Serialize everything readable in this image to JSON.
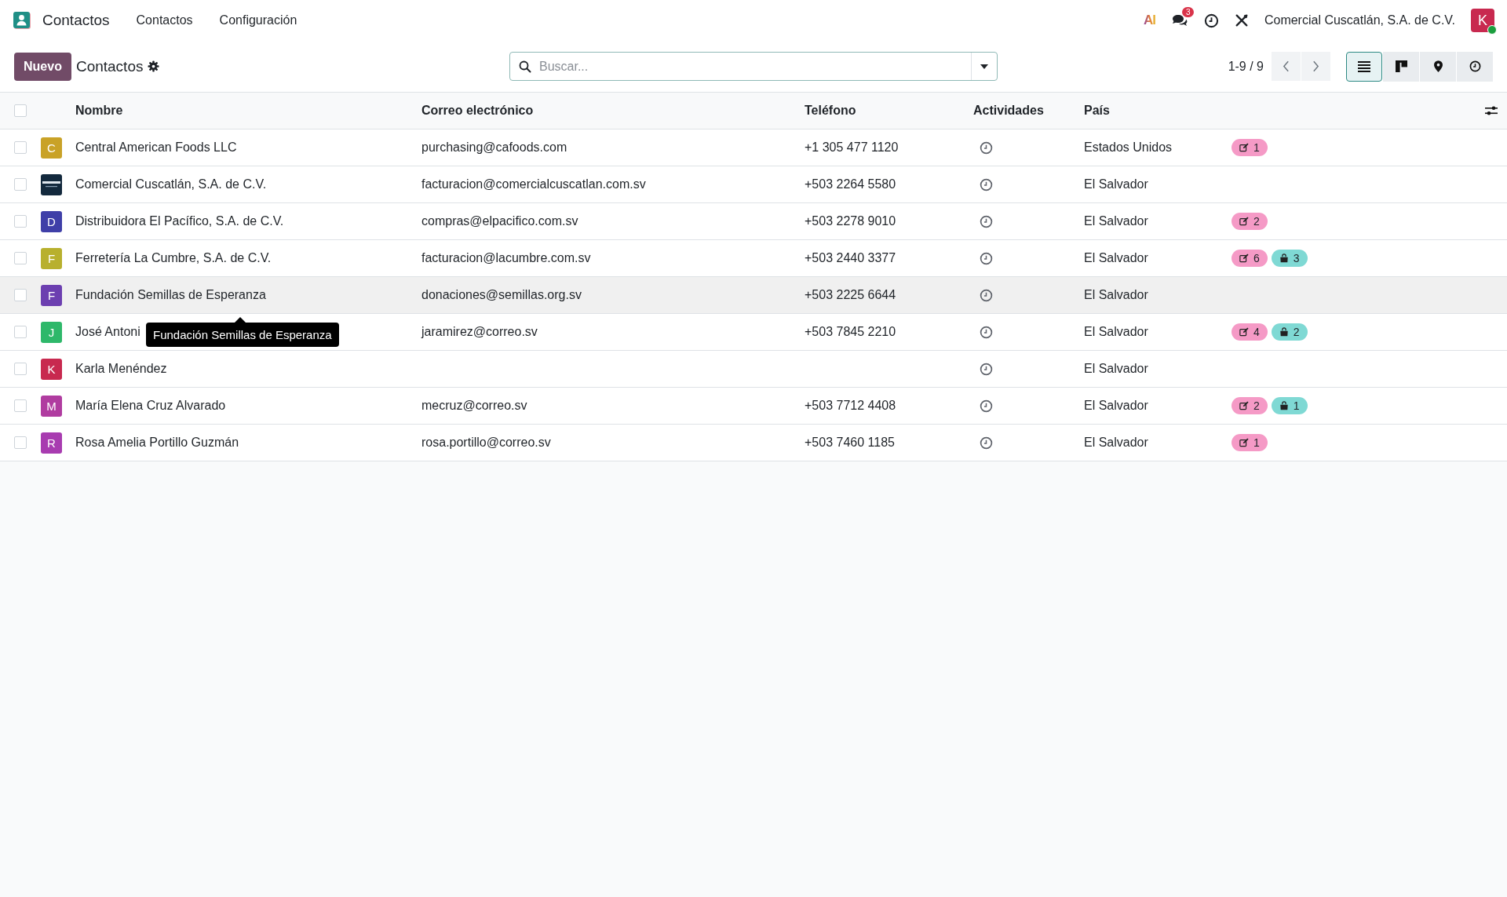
{
  "navbar": {
    "app_name": "Contactos",
    "menus": [
      "Contactos",
      "Configuración"
    ],
    "ai_label": "AI",
    "messages_badge": "3",
    "company": "Comercial Cuscatlán, S.A. de C.V.",
    "user_initial": "K",
    "user_online": true
  },
  "control_panel": {
    "new_button": "Nuevo",
    "title": "Contactos",
    "search": {
      "placeholder": "Buscar..."
    },
    "pager": "1-9 / 9",
    "views": [
      {
        "kind": "list",
        "selected": true
      },
      {
        "kind": "kanban",
        "selected": false
      },
      {
        "kind": "map",
        "selected": false
      },
      {
        "kind": "activity",
        "selected": false
      }
    ]
  },
  "table": {
    "all_selected": false,
    "columns": [
      "Nombre",
      "Correo electrónico",
      "Teléfono",
      "Actividades",
      "País"
    ],
    "rows": [
      {
        "avatar": {
          "kind": "letter",
          "letter": "C",
          "color": "#c9a227"
        },
        "name": "Central American Foods LLC",
        "email": "purchasing@cafoods.com",
        "phone": "+1 305 477 1120",
        "country": "Estados Unidos",
        "hovered": false,
        "badges": [
          {
            "kind": "note",
            "count": "1"
          }
        ]
      },
      {
        "avatar": {
          "kind": "logo"
        },
        "name": "Comercial Cuscatlán, S.A. de C.V.",
        "email": "facturacion@comercialcuscatlan.com.sv",
        "phone": "+503 2264 5580",
        "country": "El Salvador",
        "hovered": false,
        "badges": []
      },
      {
        "avatar": {
          "kind": "letter",
          "letter": "D",
          "color": "#3f3fa8"
        },
        "name": "Distribuidora El Pacífico, S.A. de C.V.",
        "email": "compras@elpacifico.com.sv",
        "phone": "+503 2278 9010",
        "country": "El Salvador",
        "hovered": false,
        "badges": [
          {
            "kind": "note",
            "count": "2"
          }
        ]
      },
      {
        "avatar": {
          "kind": "letter",
          "letter": "F",
          "color": "#b8b02e"
        },
        "name": "Ferretería La Cumbre, S.A. de C.V.",
        "email": "facturacion@lacumbre.com.sv",
        "phone": "+503 2440 3377",
        "country": "El Salvador",
        "hovered": false,
        "badges": [
          {
            "kind": "note",
            "count": "6"
          },
          {
            "kind": "bag",
            "count": "3"
          }
        ]
      },
      {
        "avatar": {
          "kind": "letter",
          "letter": "F",
          "color": "#6c3fb0"
        },
        "name": "Fundación Semillas de Esperanza",
        "email": "donaciones@semillas.org.sv",
        "phone": "+503 2225 6644",
        "country": "El Salvador",
        "hovered": true,
        "badges": []
      },
      {
        "avatar": {
          "kind": "letter",
          "letter": "J",
          "color": "#2eb86a"
        },
        "name": "José Antoni",
        "email": "jaramirez@correo.sv",
        "phone": "+503 7845 2210",
        "country": "El Salvador",
        "hovered": false,
        "badges": [
          {
            "kind": "note",
            "count": "4"
          },
          {
            "kind": "bag",
            "count": "2"
          }
        ]
      },
      {
        "avatar": {
          "kind": "letter",
          "letter": "K",
          "color": "#c8294f"
        },
        "name": "Karla Menéndez",
        "email": "",
        "phone": "",
        "country": "El Salvador",
        "hovered": false,
        "badges": []
      },
      {
        "avatar": {
          "kind": "letter",
          "letter": "M",
          "color": "#b03ca0"
        },
        "name": "María Elena Cruz Alvarado",
        "email": "mecruz@correo.sv",
        "phone": "+503 7712 4408",
        "country": "El Salvador",
        "hovered": false,
        "badges": [
          {
            "kind": "note",
            "count": "2"
          },
          {
            "kind": "bag",
            "count": "1"
          }
        ]
      },
      {
        "avatar": {
          "kind": "letter",
          "letter": "R",
          "color": "#a83cb0"
        },
        "name": "Rosa Amelia Portillo Guzmán",
        "email": "rosa.portillo@correo.sv",
        "phone": "+503 7460 1185",
        "country": "El Salvador",
        "hovered": false,
        "badges": [
          {
            "kind": "note",
            "count": "1"
          }
        ]
      }
    ]
  },
  "tooltip": "Fundación Semillas de Esperanza"
}
